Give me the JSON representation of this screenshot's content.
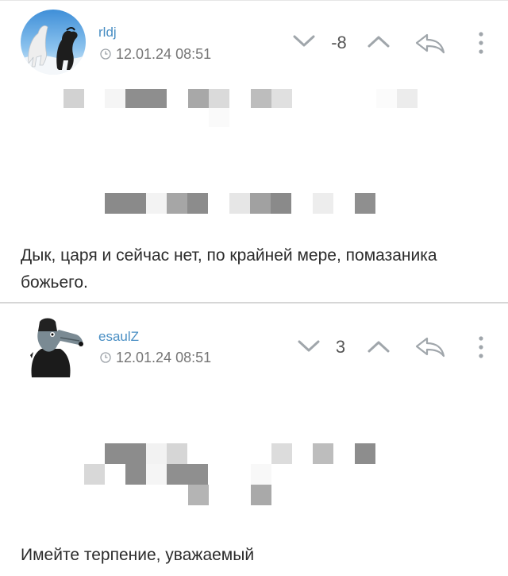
{
  "comments": [
    {
      "username": "rldj",
      "timestamp": "12.01.24 08:51",
      "score": "-8",
      "text": "Дык, царя и сейчас нет, по крайней мере, помазаника божьего.",
      "avatar_icon": "horses-avatar"
    },
    {
      "username": "esaulZ",
      "timestamp": "12.01.24 08:51",
      "score": "3",
      "text": "Имейте терпение, уважаемый",
      "avatar_icon": "wolf-avatar"
    }
  ],
  "colors": {
    "username": "#4a8fc4",
    "meta": "#757575",
    "icons": "#9aa0a6",
    "divider": "#d6d6d6"
  }
}
